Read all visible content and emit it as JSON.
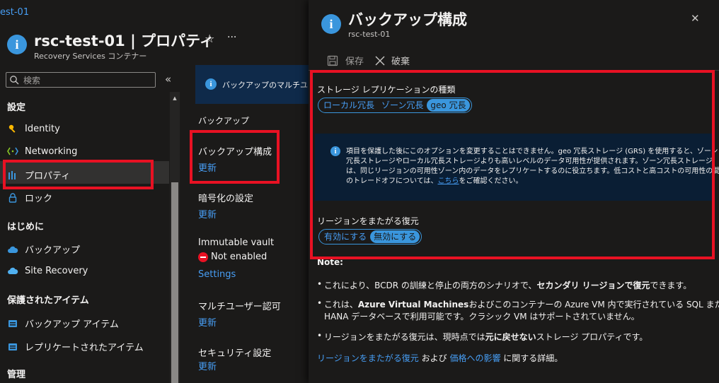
{
  "breadcrumb": "est-01",
  "blade": {
    "title": "rsc-test-01 | プロパティ",
    "subtitle": "Recovery Services コンテナー",
    "star_icon": "☆",
    "more_icon": "···"
  },
  "sidebar": {
    "search_placeholder": "検索",
    "collapse_icon": "«",
    "sections": {
      "settings": "設定",
      "getting_started": "はじめに",
      "protected_items": "保護されたアイテム",
      "manage": "管理"
    },
    "items": {
      "identity": "Identity",
      "networking": "Networking",
      "properties": "プロパティ",
      "lock": "ロック",
      "backup": "バックアップ",
      "site_recovery": "Site Recovery",
      "backup_items": "バックアップ アイテム",
      "replicated_items": "レプリケートされたアイテム"
    }
  },
  "middle": {
    "banner_text": "バックアップのマルチユーザ",
    "section_title": "バックアップ",
    "backup_config": {
      "title": "バックアップ構成",
      "link": "更新"
    },
    "encryption": {
      "title": "暗号化の設定",
      "link": "更新"
    },
    "immutable": {
      "title": "Immutable vault",
      "status": "Not enabled",
      "link": "Settings"
    },
    "multiuser": {
      "title": "マルチユーザー認可",
      "link": "更新"
    },
    "security": {
      "title": "セキュリティ設定",
      "link": "更新"
    }
  },
  "panel": {
    "title": "バックアップ構成",
    "subtitle": "rsc-test-01",
    "close_icon": "✕",
    "save_label": "保存",
    "discard_label": "破棄",
    "storage_type_label": "ストレージ レプリケーションの種類",
    "storage_options": [
      "ローカル冗長",
      "ゾーン冗長",
      "geo 冗長"
    ],
    "storage_selected": "geo 冗長",
    "info_line1": "項目を保護した後にこのオプションを変更することはできません。geo 冗長ストレージ (GRS) を使用すると、ゾーン",
    "info_line2": "冗長ストレージやローカル冗長ストレージよりも高いレベルのデータ可用性が提供されます。ゾーン冗長ストレージ",
    "info_line3": "は、同じリージョンの可用性ゾーン内のデータをレプリケートするのに役立ちます。低コストと高コストの可用性の間",
    "info_line4a": "のトレードオフについては、",
    "info_line4_link": "こちら",
    "info_line4b": "をご確認ください。",
    "cross_region_label": "リージョンをまたがる復元",
    "cross_region_options": [
      "有効にする",
      "無効にする"
    ],
    "cross_region_selected": "無効にする",
    "note_label": "Note:",
    "bullet1a": "これにより、BCDR の訓練と停止の両方のシナリオで、",
    "bullet1b": "セカンダリ リージョンで復元",
    "bullet1c": "できます。",
    "bullet2a": "これは、",
    "bullet2b": "Azure Virtual Machines",
    "bullet2c": "およびこのコンテナーの Azure VM 内で実行されている SQL または SAP",
    "bullet2d": "HANA データベースで利用可能です。クラシック VM はサポートされていません。",
    "bullet3a": "リージョンをまたがる復元は、現時点では",
    "bullet3b": "元に戻せない",
    "bullet3c": "ストレージ プロパティです。",
    "footer_link1": "リージョンをまたがる復元",
    "footer_and": "および",
    "footer_link2": "価格への影響",
    "footer_tail": "に関する詳細。"
  }
}
